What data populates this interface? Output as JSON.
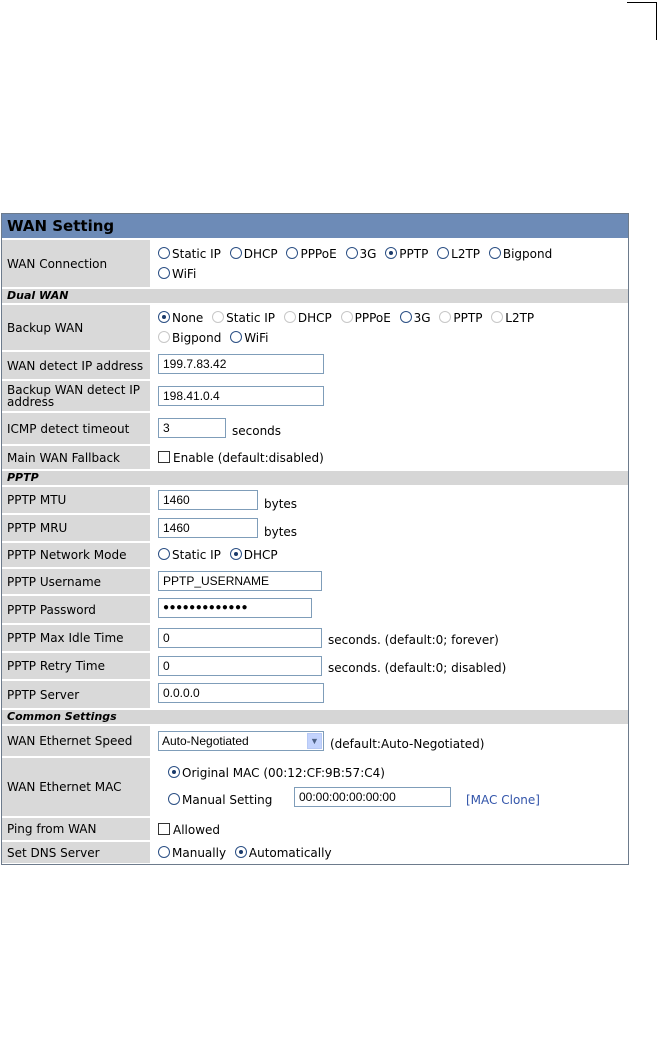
{
  "panel": {
    "title": "WAN Setting"
  },
  "wan_connection": {
    "label": "WAN Connection",
    "options": [
      "Static IP",
      "DHCP",
      "PPPoE",
      "3G",
      "PPTP",
      "L2TP",
      "Bigpond",
      "WiFi"
    ],
    "selected": "PPTP"
  },
  "dual_wan": {
    "section": "Dual WAN",
    "backup_label": "Backup WAN",
    "backup_options": [
      "None",
      "Static IP",
      "DHCP",
      "PPPoE",
      "3G",
      "PPTP",
      "L2TP",
      "Bigpond",
      "WiFi"
    ],
    "backup_selected": "None",
    "detect_ip_label": "WAN detect IP address",
    "detect_ip_value": "199.7.83.42",
    "backup_detect_label": "Backup WAN detect IP address",
    "backup_detect_value": "198.41.0.4",
    "icmp_label": "ICMP detect timeout",
    "icmp_value": "3",
    "icmp_unit": "seconds",
    "fallback_label": "Main WAN Fallback",
    "fallback_text": "Enable (default:disabled)",
    "fallback_checked": false
  },
  "pptp": {
    "section": "PPTP",
    "mtu_label": "PPTP MTU",
    "mtu_value": "1460",
    "mtu_unit": "bytes",
    "mru_label": "PPTP MRU",
    "mru_value": "1460",
    "mru_unit": "bytes",
    "mode_label": "PPTP Network Mode",
    "mode_static": "Static IP",
    "mode_dhcp": "DHCP",
    "mode_selected": "DHCP",
    "username_label": "PPTP Username",
    "username_value": "PPTP_USERNAME",
    "password_label": "PPTP Password",
    "password_value": "●●●●●●●●●●●●●",
    "idle_label": "PPTP Max Idle Time",
    "idle_value": "0",
    "idle_unit": "seconds. (default:0; forever)",
    "retry_label": "PPTP Retry Time",
    "retry_value": "0",
    "retry_unit": "seconds. (default:0; disabled)",
    "server_label": "PPTP Server",
    "server_value": "0.0.0.0"
  },
  "common": {
    "section": "Common Settings",
    "speed_label": "WAN Ethernet Speed",
    "speed_value": "Auto-Negotiated",
    "speed_default": "(default:Auto-Negotiated)",
    "mac_label": "WAN Ethernet MAC",
    "mac_original": "Original MAC (00:12:CF:9B:57:C4)",
    "mac_manual": "Manual Setting",
    "mac_manual_value": "00:00:00:00:00:00",
    "mac_clone": "[MAC Clone]",
    "mac_selected": "Original MAC",
    "ping_label": "Ping from WAN",
    "ping_text": "Allowed",
    "ping_checked": false,
    "dns_label": "Set DNS Server",
    "dns_manual": "Manually",
    "dns_auto": "Automatically",
    "dns_selected": "Automatically"
  },
  "colors": {
    "title_bar": "#6d8bb7",
    "label_bg": "#d9d9d9",
    "section_bg": "#d6d6d6",
    "link": "#3355aa"
  }
}
